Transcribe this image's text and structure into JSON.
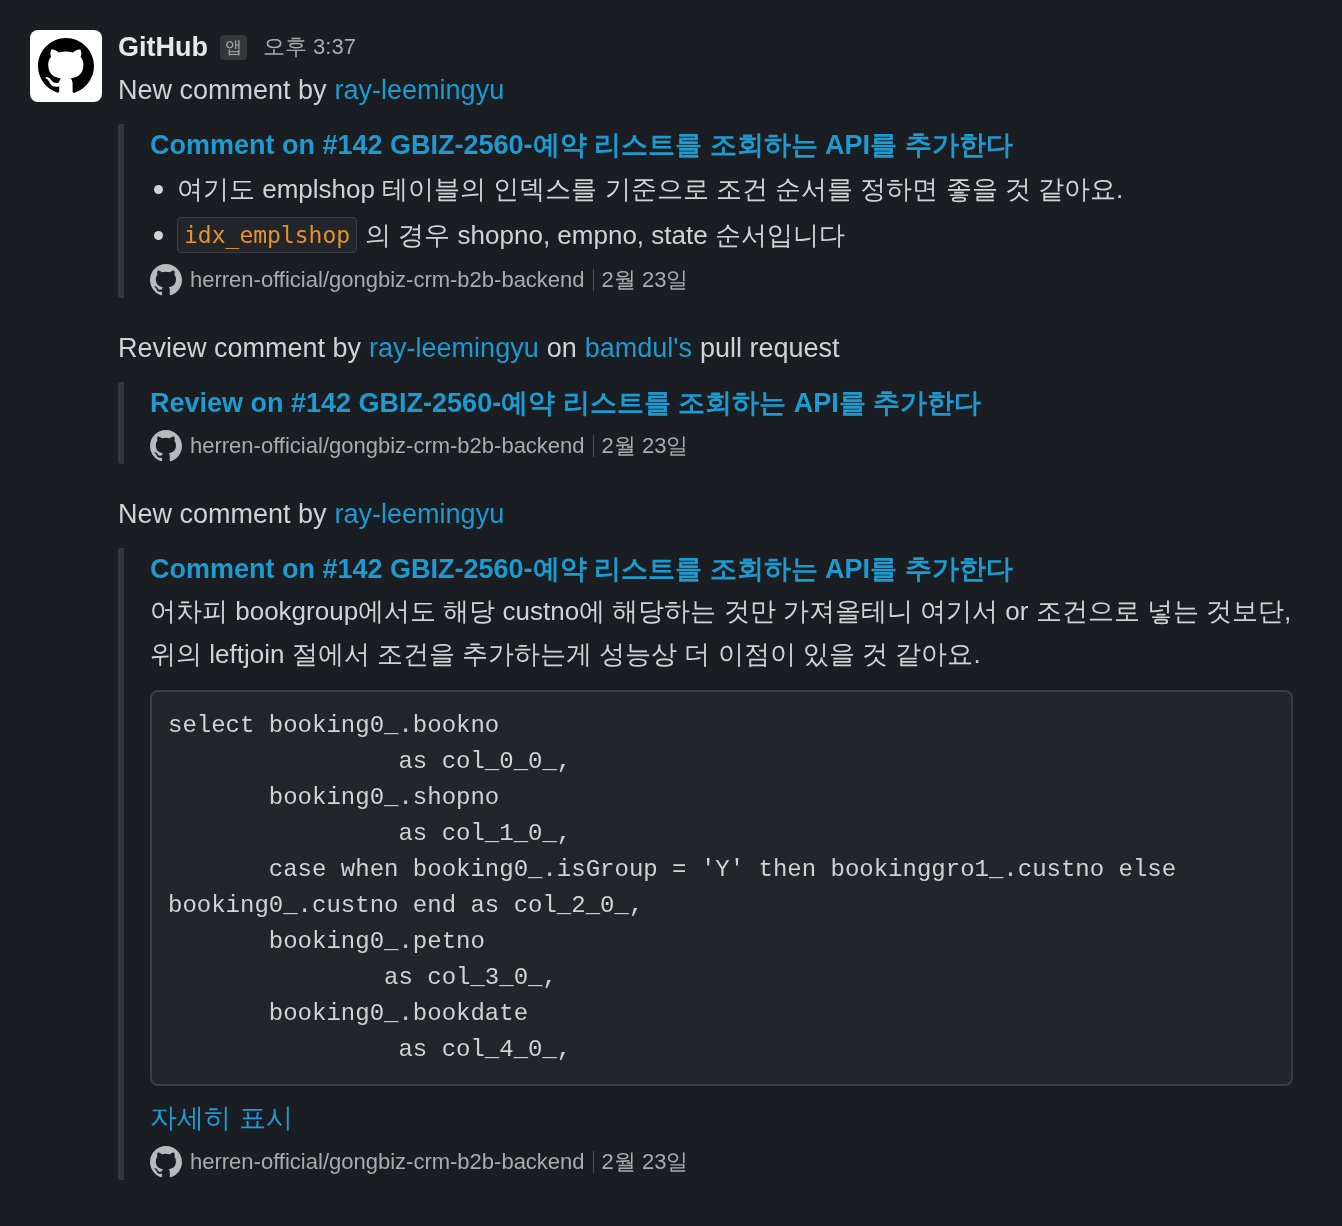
{
  "message": {
    "sender": "GitHub",
    "badge": "앱",
    "time": "오후 3:37"
  },
  "entries": [
    {
      "intro": [
        {
          "kind": "text",
          "text": "New comment by"
        },
        {
          "kind": "link",
          "text": "ray-leemingyu"
        }
      ],
      "attachment": {
        "title": "Comment on #142 GBIZ-2560-예약 리스트를 조회하는 API를 추가한다",
        "bullets": [
          [
            {
              "kind": "text",
              "text": "여기도 emplshop 테이블의 인덱스를 기준으로 조건 순서를 정하면 좋을 것 같아요."
            }
          ],
          [
            {
              "kind": "code",
              "text": "idx_emplshop"
            },
            {
              "kind": "text",
              "text": "의 경우 shopno, empno, state 순서입니다"
            }
          ]
        ],
        "footer": {
          "repo": "herren-official/gongbiz-crm-b2b-backend",
          "date": "2월 23일"
        }
      }
    },
    {
      "intro": [
        {
          "kind": "text",
          "text": "Review comment by"
        },
        {
          "kind": "link",
          "text": "ray-leemingyu"
        },
        {
          "kind": "text",
          "text": "on"
        },
        {
          "kind": "link",
          "text": "bamdul's"
        },
        {
          "kind": "text",
          "text": "pull request"
        }
      ],
      "attachment": {
        "title": "Review on #142 GBIZ-2560-예약 리스트를 조회하는 API를 추가한다",
        "footer": {
          "repo": "herren-official/gongbiz-crm-b2b-backend",
          "date": "2월 23일"
        }
      }
    },
    {
      "intro": [
        {
          "kind": "text",
          "text": "New comment by"
        },
        {
          "kind": "link",
          "text": "ray-leemingyu"
        }
      ],
      "attachment": {
        "title": "Comment on #142 GBIZ-2560-예약 리스트를 조회하는 API를 추가한다",
        "paragraph": "어차피 bookgroup에서도 해당 custno에 해당하는 것만 가져올테니 여기서 or 조건으로 넣는 것보단, 위의 leftjoin 절에서 조건을 추가하는게 성능상 더 이점이 있을 것 같아요.",
        "code": "select booking0_.bookno\n                as col_0_0_,\n       booking0_.shopno\n                as col_1_0_,\n       case when booking0_.isGroup = 'Y' then bookinggro1_.custno else\nbooking0_.custno end as col_2_0_,\n       booking0_.petno\n               as col_3_0_,\n       booking0_.bookdate\n                as col_4_0_,",
        "more": "자세히 표시",
        "footer": {
          "repo": "herren-official/gongbiz-crm-b2b-backend",
          "date": "2월 23일"
        }
      }
    }
  ]
}
